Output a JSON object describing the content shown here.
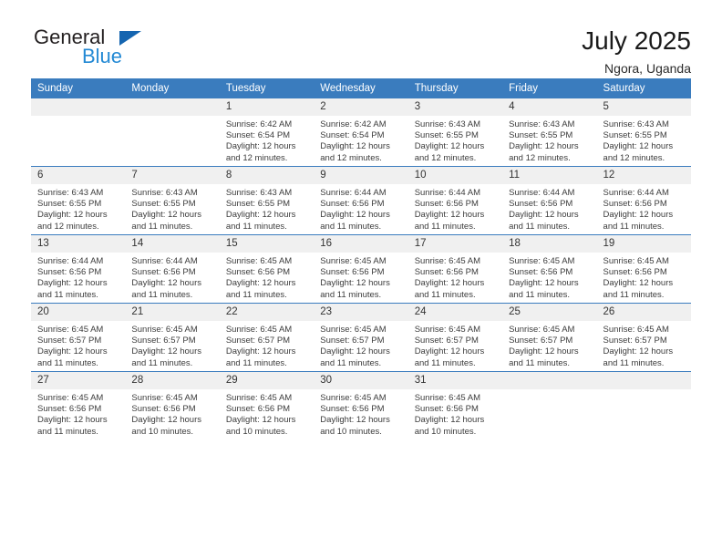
{
  "brand": {
    "word_top": "General",
    "word_bottom": "Blue",
    "triangle_color": "#1565b0",
    "blue_color": "#2389d4"
  },
  "header": {
    "title": "July 2025",
    "subtitle": "Ngora, Uganda"
  },
  "theme": {
    "header_blue": "#3a7cbe",
    "daynum_gray": "#f0f0f0",
    "text": "#3c3c3c"
  },
  "weekday_headers": [
    "Sunday",
    "Monday",
    "Tuesday",
    "Wednesday",
    "Thursday",
    "Friday",
    "Saturday"
  ],
  "weeks": [
    [
      {
        "day": "",
        "empty": true
      },
      {
        "day": "",
        "empty": true
      },
      {
        "day": "1",
        "sunrise": "Sunrise: 6:42 AM",
        "sunset": "Sunset: 6:54 PM",
        "daylight_line1": "Daylight: 12 hours",
        "daylight_line2": "and 12 minutes."
      },
      {
        "day": "2",
        "sunrise": "Sunrise: 6:42 AM",
        "sunset": "Sunset: 6:54 PM",
        "daylight_line1": "Daylight: 12 hours",
        "daylight_line2": "and 12 minutes."
      },
      {
        "day": "3",
        "sunrise": "Sunrise: 6:43 AM",
        "sunset": "Sunset: 6:55 PM",
        "daylight_line1": "Daylight: 12 hours",
        "daylight_line2": "and 12 minutes."
      },
      {
        "day": "4",
        "sunrise": "Sunrise: 6:43 AM",
        "sunset": "Sunset: 6:55 PM",
        "daylight_line1": "Daylight: 12 hours",
        "daylight_line2": "and 12 minutes."
      },
      {
        "day": "5",
        "sunrise": "Sunrise: 6:43 AM",
        "sunset": "Sunset: 6:55 PM",
        "daylight_line1": "Daylight: 12 hours",
        "daylight_line2": "and 12 minutes."
      }
    ],
    [
      {
        "day": "6",
        "sunrise": "Sunrise: 6:43 AM",
        "sunset": "Sunset: 6:55 PM",
        "daylight_line1": "Daylight: 12 hours",
        "daylight_line2": "and 12 minutes."
      },
      {
        "day": "7",
        "sunrise": "Sunrise: 6:43 AM",
        "sunset": "Sunset: 6:55 PM",
        "daylight_line1": "Daylight: 12 hours",
        "daylight_line2": "and 11 minutes."
      },
      {
        "day": "8",
        "sunrise": "Sunrise: 6:43 AM",
        "sunset": "Sunset: 6:55 PM",
        "daylight_line1": "Daylight: 12 hours",
        "daylight_line2": "and 11 minutes."
      },
      {
        "day": "9",
        "sunrise": "Sunrise: 6:44 AM",
        "sunset": "Sunset: 6:56 PM",
        "daylight_line1": "Daylight: 12 hours",
        "daylight_line2": "and 11 minutes."
      },
      {
        "day": "10",
        "sunrise": "Sunrise: 6:44 AM",
        "sunset": "Sunset: 6:56 PM",
        "daylight_line1": "Daylight: 12 hours",
        "daylight_line2": "and 11 minutes."
      },
      {
        "day": "11",
        "sunrise": "Sunrise: 6:44 AM",
        "sunset": "Sunset: 6:56 PM",
        "daylight_line1": "Daylight: 12 hours",
        "daylight_line2": "and 11 minutes."
      },
      {
        "day": "12",
        "sunrise": "Sunrise: 6:44 AM",
        "sunset": "Sunset: 6:56 PM",
        "daylight_line1": "Daylight: 12 hours",
        "daylight_line2": "and 11 minutes."
      }
    ],
    [
      {
        "day": "13",
        "sunrise": "Sunrise: 6:44 AM",
        "sunset": "Sunset: 6:56 PM",
        "daylight_line1": "Daylight: 12 hours",
        "daylight_line2": "and 11 minutes."
      },
      {
        "day": "14",
        "sunrise": "Sunrise: 6:44 AM",
        "sunset": "Sunset: 6:56 PM",
        "daylight_line1": "Daylight: 12 hours",
        "daylight_line2": "and 11 minutes."
      },
      {
        "day": "15",
        "sunrise": "Sunrise: 6:45 AM",
        "sunset": "Sunset: 6:56 PM",
        "daylight_line1": "Daylight: 12 hours",
        "daylight_line2": "and 11 minutes."
      },
      {
        "day": "16",
        "sunrise": "Sunrise: 6:45 AM",
        "sunset": "Sunset: 6:56 PM",
        "daylight_line1": "Daylight: 12 hours",
        "daylight_line2": "and 11 minutes."
      },
      {
        "day": "17",
        "sunrise": "Sunrise: 6:45 AM",
        "sunset": "Sunset: 6:56 PM",
        "daylight_line1": "Daylight: 12 hours",
        "daylight_line2": "and 11 minutes."
      },
      {
        "day": "18",
        "sunrise": "Sunrise: 6:45 AM",
        "sunset": "Sunset: 6:56 PM",
        "daylight_line1": "Daylight: 12 hours",
        "daylight_line2": "and 11 minutes."
      },
      {
        "day": "19",
        "sunrise": "Sunrise: 6:45 AM",
        "sunset": "Sunset: 6:56 PM",
        "daylight_line1": "Daylight: 12 hours",
        "daylight_line2": "and 11 minutes."
      }
    ],
    [
      {
        "day": "20",
        "sunrise": "Sunrise: 6:45 AM",
        "sunset": "Sunset: 6:57 PM",
        "daylight_line1": "Daylight: 12 hours",
        "daylight_line2": "and 11 minutes."
      },
      {
        "day": "21",
        "sunrise": "Sunrise: 6:45 AM",
        "sunset": "Sunset: 6:57 PM",
        "daylight_line1": "Daylight: 12 hours",
        "daylight_line2": "and 11 minutes."
      },
      {
        "day": "22",
        "sunrise": "Sunrise: 6:45 AM",
        "sunset": "Sunset: 6:57 PM",
        "daylight_line1": "Daylight: 12 hours",
        "daylight_line2": "and 11 minutes."
      },
      {
        "day": "23",
        "sunrise": "Sunrise: 6:45 AM",
        "sunset": "Sunset: 6:57 PM",
        "daylight_line1": "Daylight: 12 hours",
        "daylight_line2": "and 11 minutes."
      },
      {
        "day": "24",
        "sunrise": "Sunrise: 6:45 AM",
        "sunset": "Sunset: 6:57 PM",
        "daylight_line1": "Daylight: 12 hours",
        "daylight_line2": "and 11 minutes."
      },
      {
        "day": "25",
        "sunrise": "Sunrise: 6:45 AM",
        "sunset": "Sunset: 6:57 PM",
        "daylight_line1": "Daylight: 12 hours",
        "daylight_line2": "and 11 minutes."
      },
      {
        "day": "26",
        "sunrise": "Sunrise: 6:45 AM",
        "sunset": "Sunset: 6:57 PM",
        "daylight_line1": "Daylight: 12 hours",
        "daylight_line2": "and 11 minutes."
      }
    ],
    [
      {
        "day": "27",
        "sunrise": "Sunrise: 6:45 AM",
        "sunset": "Sunset: 6:56 PM",
        "daylight_line1": "Daylight: 12 hours",
        "daylight_line2": "and 11 minutes."
      },
      {
        "day": "28",
        "sunrise": "Sunrise: 6:45 AM",
        "sunset": "Sunset: 6:56 PM",
        "daylight_line1": "Daylight: 12 hours",
        "daylight_line2": "and 10 minutes."
      },
      {
        "day": "29",
        "sunrise": "Sunrise: 6:45 AM",
        "sunset": "Sunset: 6:56 PM",
        "daylight_line1": "Daylight: 12 hours",
        "daylight_line2": "and 10 minutes."
      },
      {
        "day": "30",
        "sunrise": "Sunrise: 6:45 AM",
        "sunset": "Sunset: 6:56 PM",
        "daylight_line1": "Daylight: 12 hours",
        "daylight_line2": "and 10 minutes."
      },
      {
        "day": "31",
        "sunrise": "Sunrise: 6:45 AM",
        "sunset": "Sunset: 6:56 PM",
        "daylight_line1": "Daylight: 12 hours",
        "daylight_line2": "and 10 minutes."
      },
      {
        "day": "",
        "empty": true
      },
      {
        "day": "",
        "empty": true
      }
    ]
  ]
}
